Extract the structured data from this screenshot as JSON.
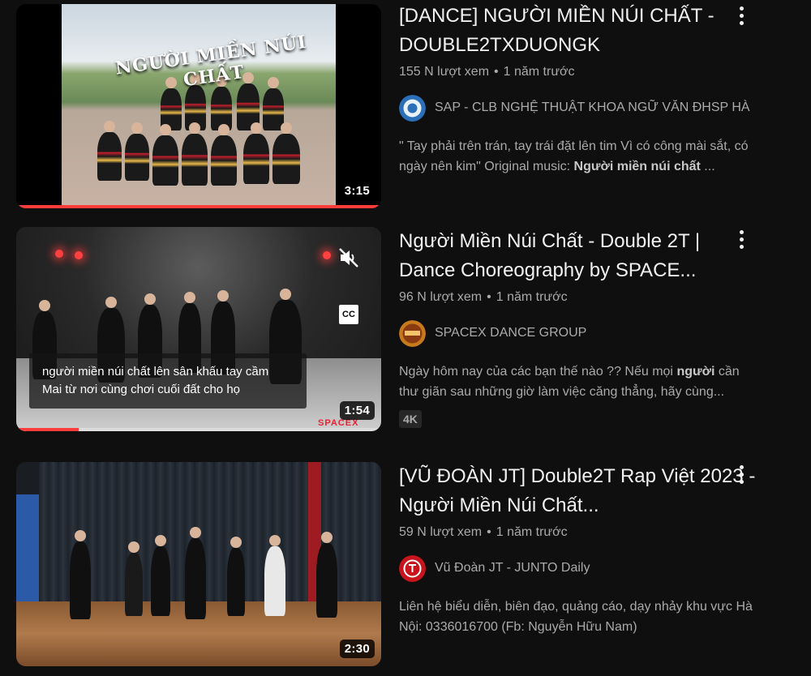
{
  "videos": [
    {
      "title": "[DANCE] NGƯỜI MIỀN NÚI CHẤT - DOUBLE2TXDUONGK",
      "views": "155 N lượt xem",
      "age": "1 năm trước",
      "channel": "SAP - CLB NGHỆ THUẬT KHOA NGỮ VĂN ĐHSP HÀ",
      "description_before": "\" Tay phải trên trán, tay trái đặt lên tim Vì có công mài sắt, có ngày nên kim\" Original music: ",
      "description_bold": "Người miền núi chất",
      "description_after": " ...",
      "duration": "3:15",
      "thumbnail_caption": "NGƯỜI MIỀN NÚI CHẤT",
      "watch_progress": 1.0,
      "avatar_icon": "sap-club-logo"
    },
    {
      "title": "Người Miền Núi Chất - Double 2T | Dance Choreography by SPACE...",
      "views": "96 N lượt xem",
      "age": "1 năm trước",
      "channel": "SPACEX DANCE GROUP",
      "description_before": "Ngày hôm nay của các bạn thế nào ?? Nếu mọi ",
      "description_bold": "người",
      "description_after": " cần thư giãn sau những giờ làm việc căng thẳng, hãy cùng...",
      "badge": "4K",
      "duration": "1:54",
      "subtitle_line1": "người miền núi chất lên sân khấu tay cầm",
      "subtitle_line2": "Mai từ nơi cùng chơi cuối đất cho họ",
      "cc_label": "CC",
      "watermark": "SPACEX",
      "watch_progress": 0.17,
      "avatar_icon": "spacex-dance-logo"
    },
    {
      "title": "[VŨ ĐOÀN JT] Double2T Rap Việt 2023 - Người Miền Núi Chất...",
      "views": "59 N lượt xem",
      "age": "1 năm trước",
      "channel": "Vũ Đoàn JT - JUNTO Daily",
      "description_before": "Liên hệ biểu diễn, biên đạo, quảng cáo, dạy nhảy khu vực Hà Nội: 0336016700 (Fb: Nguyễn Hữu Nam)",
      "description_bold": "",
      "description_after": "",
      "duration": "2:30",
      "avatar_icon": "junto-logo"
    }
  ],
  "colors": {
    "background": "#0f0f0f",
    "progress": "#ff3c3c",
    "text_primary": "#f1f1f1",
    "text_secondary": "#aaaaaa"
  },
  "separator": "•"
}
